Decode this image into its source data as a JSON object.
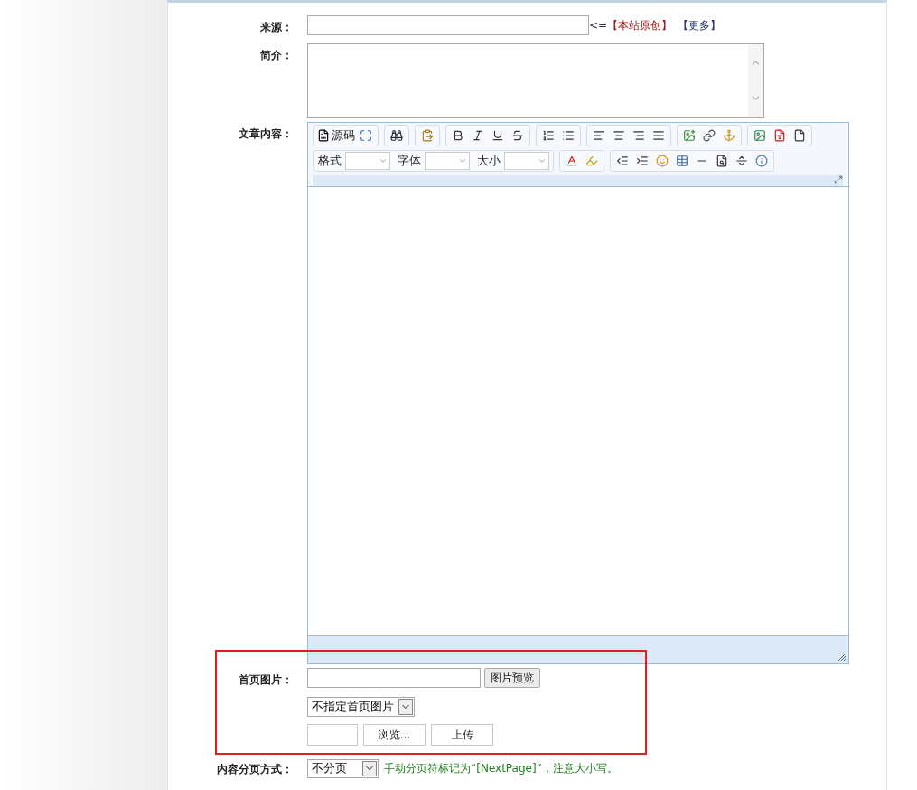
{
  "form": {
    "source": {
      "label": "来源：",
      "prefix": "<=",
      "original_link": "【本站原创】",
      "more_link": "【更多】"
    },
    "summary": {
      "label": "简介："
    },
    "content": {
      "label": "文章内容：",
      "editor": {
        "source_label": "源码",
        "format_label": "格式",
        "font_label": "字体",
        "size_label": "大小"
      }
    },
    "cover_image": {
      "label": "首页图片：",
      "preview_button": "图片预览",
      "select_value": "不指定首页图片",
      "browse_button": "浏览...",
      "upload_button": "上传",
      "highlighted": true
    },
    "pagination": {
      "label": "内容分页方式：",
      "select_value": "不分页",
      "hint": "手动分页符标记为“[NextPage]”，注意大小写。"
    }
  }
}
